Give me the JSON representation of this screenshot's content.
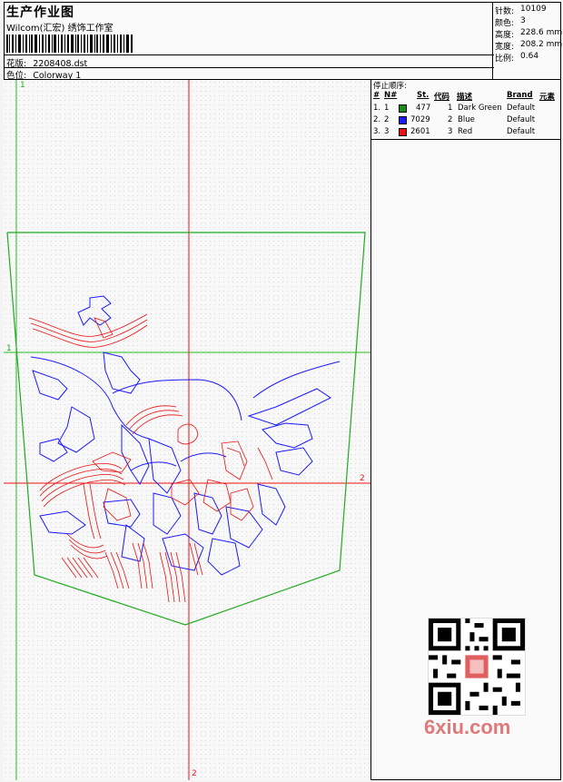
{
  "header": {
    "title": "生产作业图",
    "subtitle": "Wilcom(汇宏) 绣饰工作室",
    "design_label": "花版:",
    "design_value": "2208408.dst",
    "colorway_label": "色位:",
    "colorway_value": "Colorway 1"
  },
  "stats": {
    "stitches_label": "针数:",
    "stitches_value": "10109",
    "colors_label": "颜色:",
    "colors_value": "3",
    "height_label": "高度:",
    "height_value": "228.6 mm",
    "width_label": "宽度:",
    "width_value": "208.2 mm",
    "scale_label": "比例:",
    "scale_value": "0.64"
  },
  "stop_sequence": {
    "title": "停止顺序:",
    "columns": [
      "#",
      "N#",
      "St.",
      "代码",
      "描述",
      "Brand",
      "元素"
    ],
    "rows": [
      {
        "idx": "1.",
        "n": "1",
        "st": "477",
        "code": "1",
        "desc": "Dark Green",
        "brand": "Default",
        "color": "#1a8a1a"
      },
      {
        "idx": "2.",
        "n": "2",
        "st": "7029",
        "code": "2",
        "desc": "Blue",
        "brand": "Default",
        "color": "#1a1aff"
      },
      {
        "idx": "3.",
        "n": "3",
        "st": "2601",
        "code": "3",
        "desc": "Red",
        "brand": "Default",
        "color": "#ee1111"
      }
    ]
  },
  "axis_labels": {
    "h1": "1",
    "v1": "1",
    "h2": "2",
    "v2": "2"
  },
  "watermark": "6xiu.com",
  "colors": {
    "green": "#22aa22",
    "red": "#ee1111",
    "blue": "#1a1aff"
  }
}
